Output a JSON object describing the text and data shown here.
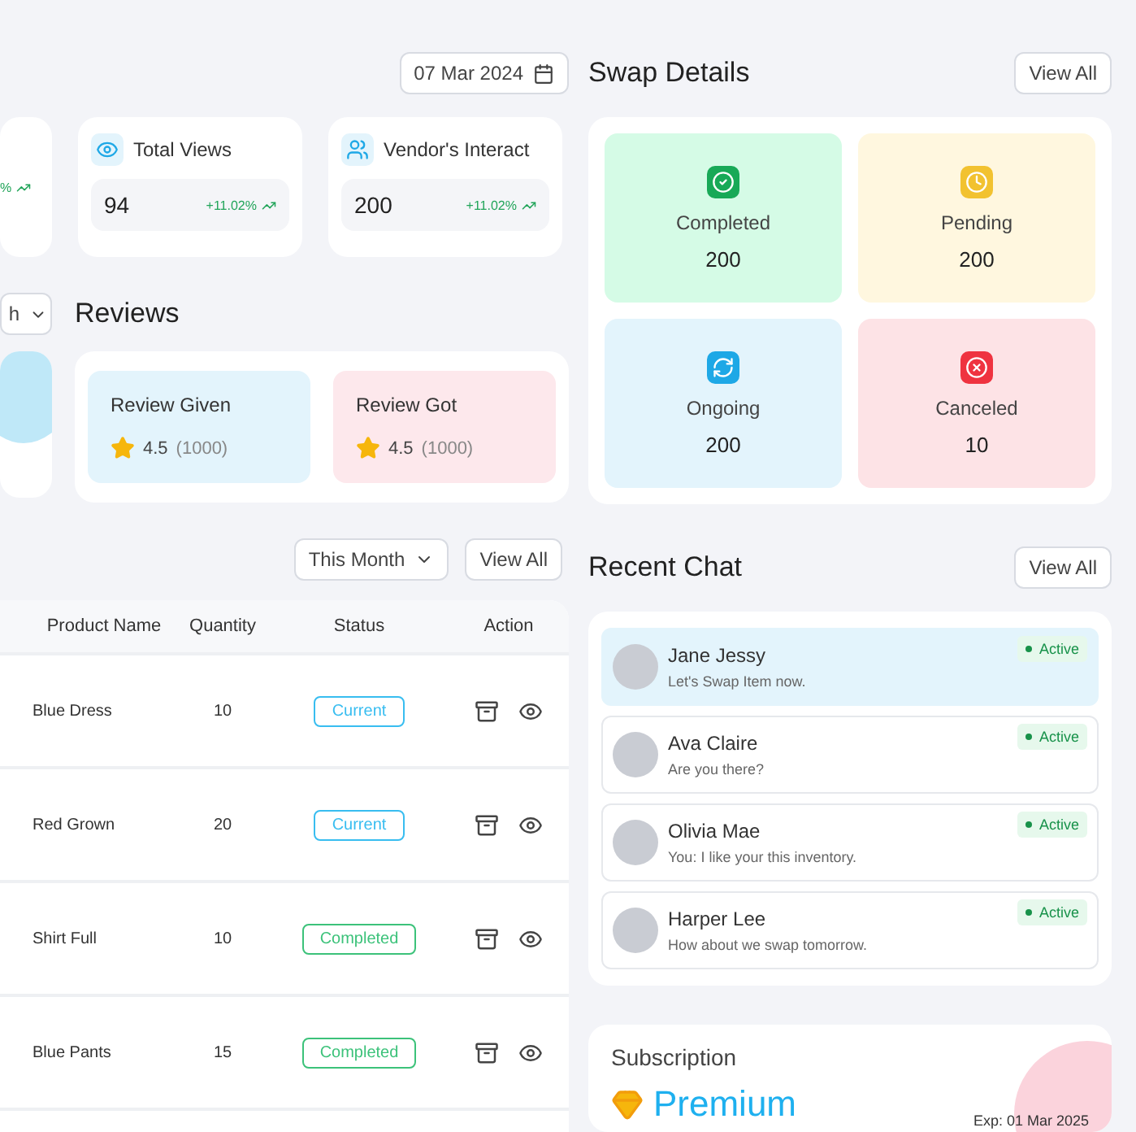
{
  "date_button": {
    "label": "07 Mar 2024"
  },
  "stats": [
    {
      "kind": "partial",
      "change": "%"
    },
    {
      "kind": "views",
      "title": "Total Views",
      "value": "94",
      "change": "+11.02%"
    },
    {
      "kind": "vendors",
      "title": "Vendor's Interact",
      "value": "200",
      "change": "+11.02%"
    }
  ],
  "period_dropdown_partial": {
    "label": "h"
  },
  "reviews": {
    "title": "Reviews",
    "items": [
      {
        "label": "Review Given",
        "rating": "4.5",
        "count": "(1000)",
        "color": "#e3f4fc"
      },
      {
        "label": "Review Got",
        "rating": "4.5",
        "count": "(1000)",
        "color": "#fde8ec"
      }
    ]
  },
  "table_toolbar": {
    "period": "This Month",
    "view_all": "View All"
  },
  "table": {
    "columns": [
      "Product Name",
      "Quantity",
      "Status",
      "Action"
    ],
    "rows": [
      {
        "product": "Blue Dress",
        "quantity": "10",
        "status": "Current",
        "kind": "current"
      },
      {
        "product": "Red Grown",
        "quantity": "20",
        "status": "Current",
        "kind": "current"
      },
      {
        "product": "Shirt Full",
        "quantity": "10",
        "status": "Completed",
        "kind": "completed"
      },
      {
        "product": "Blue Pants",
        "quantity": "15",
        "status": "Completed",
        "kind": "completed"
      }
    ]
  },
  "swap_details": {
    "title": "Swap Details",
    "view_all": "View All",
    "tiles": [
      {
        "kind": "completed",
        "label": "Completed",
        "value": "200",
        "color": "#d5fbe6"
      },
      {
        "kind": "pending",
        "label": "Pending",
        "value": "200",
        "color": "#fff7df"
      },
      {
        "kind": "ongoing",
        "label": "Ongoing",
        "value": "200",
        "color": "#e3f4fc"
      },
      {
        "kind": "canceled",
        "label": "Canceled",
        "value": "10",
        "color": "#fde3e6"
      }
    ]
  },
  "recent_chat": {
    "title": "Recent Chat",
    "view_all": "View All",
    "items": [
      {
        "name": "Jane Jessy",
        "message": "Let's Swap Item now.",
        "status": "Active",
        "selected": true
      },
      {
        "name": "Ava Claire",
        "message": "Are you there?",
        "status": "Active",
        "selected": false
      },
      {
        "name": "Olivia Mae",
        "message": "You: I like your this inventory.",
        "status": "Active",
        "selected": false
      },
      {
        "name": "Harper Lee",
        "message": "How about we swap tomorrow.",
        "status": "Active",
        "selected": false
      }
    ]
  },
  "subscription": {
    "title": "Subscription",
    "plan": "Premium",
    "expiry": "Exp: 01 Mar 2025"
  }
}
